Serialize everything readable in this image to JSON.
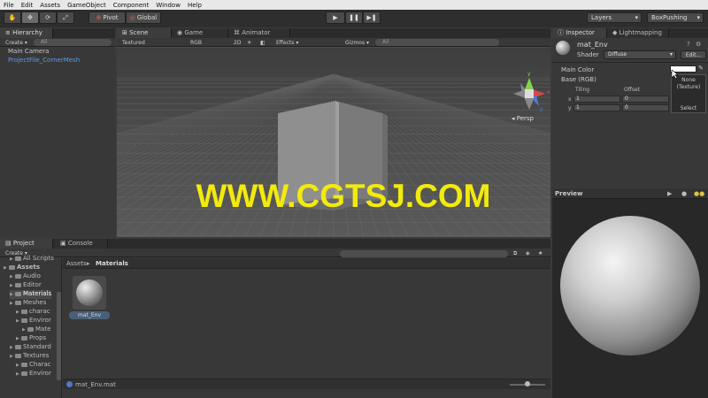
{
  "menu": [
    "File",
    "Edit",
    "Assets",
    "GameObject",
    "Component",
    "Window",
    "Help"
  ],
  "toolbar": {
    "pivot": "Pivot",
    "global": "Global",
    "layers": "Layers",
    "layout": "BoxPushing"
  },
  "hierarchy": {
    "tab": "Hierarchy",
    "create": "Create",
    "search_placeholder": "All",
    "items": [
      "Main Camera",
      "ProjectFile_CornerMesh"
    ]
  },
  "scene": {
    "tabs": [
      "Scene",
      "Game",
      "Animator"
    ],
    "render_mode": "Textured",
    "color_mode": "RGB",
    "mode_2d": "2D",
    "effects": "Effects",
    "gizmos": "Gizmos",
    "search_placeholder": "All",
    "persp": "Persp",
    "axis_y": "y",
    "axis_x": "x",
    "axis_z": "z",
    "watermark": "WWW.CGTSJ.COM"
  },
  "project": {
    "tabs": [
      "Project",
      "Console"
    ],
    "create": "Create",
    "breadcrumb_root": "Assets",
    "breadcrumb_sep": "▸",
    "breadcrumb_current": "Materials",
    "tree": [
      {
        "label": "All Scripts",
        "indent": 1
      },
      {
        "label": "Assets",
        "indent": 0
      },
      {
        "label": "Audio",
        "indent": 1
      },
      {
        "label": "Editor",
        "indent": 1
      },
      {
        "label": "Materials",
        "indent": 1
      },
      {
        "label": "Meshes",
        "indent": 1
      },
      {
        "label": "charac",
        "indent": 2
      },
      {
        "label": "Enviror",
        "indent": 2
      },
      {
        "label": "Mate",
        "indent": 3
      },
      {
        "label": "Props",
        "indent": 2
      },
      {
        "label": "Standard",
        "indent": 1
      },
      {
        "label": "Textures",
        "indent": 1
      },
      {
        "label": "Charac",
        "indent": 2
      },
      {
        "label": "Enviror",
        "indent": 2
      }
    ],
    "asset_name": "mat_Env",
    "selected_path": "mat_Env.mat"
  },
  "inspector": {
    "tabs": [
      "Inspector",
      "Lightmapping"
    ],
    "material_name": "mat_Env",
    "shader_label": "Shader",
    "shader_value": "Diffuse",
    "edit_button": "Edit...",
    "main_color_label": "Main Color",
    "base_label": "Base (RGB)",
    "tiling_label": "Tiling",
    "offset_label": "Offset",
    "x_label": "x",
    "y_label": "y",
    "tiling_x": "1",
    "tiling_y": "1",
    "offset_x": "0",
    "offset_y": "0",
    "texture_none": "None",
    "texture_kind": "(Texture)",
    "select_button": "Select",
    "preview_label": "Preview"
  },
  "colors": {
    "selected_text": "#5b9ded",
    "watermark": "#f2ea0c"
  }
}
